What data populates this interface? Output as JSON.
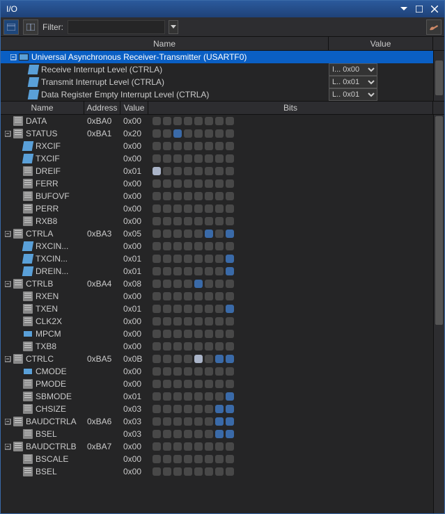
{
  "window": {
    "title": "I/O"
  },
  "toolbar": {
    "filter_label": "Filter:",
    "filter_value": ""
  },
  "upper_headers": {
    "name": "Name",
    "value": "Value"
  },
  "tree": {
    "root": "Universal Asynchronous Receiver-Transmitter (USARTF0)",
    "children": [
      {
        "label": "Receive Interrupt Level (CTRLA)",
        "value": "I... 0x00"
      },
      {
        "label": "Transmit Interrupt Level (CTRLA)",
        "value": "L.. 0x01"
      },
      {
        "label": "Data Register Empty Interrupt Level (CTRLA)",
        "value": "L.. 0x01"
      }
    ]
  },
  "lower_headers": {
    "name": "Name",
    "address": "Address",
    "value": "Value",
    "bits": "Bits"
  },
  "registers": [
    {
      "name": "DATA",
      "addr": "0xBA0",
      "val": "0x00",
      "indent": 0,
      "icon": "doc",
      "expand": null,
      "bits": [
        0,
        0,
        0,
        0,
        0,
        0,
        0,
        0
      ]
    },
    {
      "name": "STATUS",
      "addr": "0xBA1",
      "val": "0x20",
      "indent": 0,
      "icon": "doc",
      "expand": "open",
      "bits": [
        0,
        0,
        2,
        0,
        0,
        0,
        0,
        0
      ]
    },
    {
      "name": "RXCIF",
      "addr": "",
      "val": "0x00",
      "indent": 1,
      "icon": "flag",
      "expand": null,
      "bits": [
        0,
        0,
        0,
        0,
        0,
        0,
        0,
        0
      ]
    },
    {
      "name": "TXCIF",
      "addr": "",
      "val": "0x00",
      "indent": 1,
      "icon": "flag",
      "expand": null,
      "bits": [
        0,
        0,
        0,
        0,
        0,
        0,
        0,
        0
      ]
    },
    {
      "name": "DREIF",
      "addr": "",
      "val": "0x01",
      "indent": 1,
      "icon": "doc",
      "expand": null,
      "bits": [
        1,
        0,
        0,
        0,
        0,
        0,
        0,
        0
      ]
    },
    {
      "name": "FERR",
      "addr": "",
      "val": "0x00",
      "indent": 1,
      "icon": "doc",
      "expand": null,
      "bits": [
        0,
        0,
        0,
        0,
        0,
        0,
        0,
        0
      ]
    },
    {
      "name": "BUFOVF",
      "addr": "",
      "val": "0x00",
      "indent": 1,
      "icon": "doc",
      "expand": null,
      "bits": [
        0,
        0,
        0,
        0,
        0,
        0,
        0,
        0
      ]
    },
    {
      "name": "PERR",
      "addr": "",
      "val": "0x00",
      "indent": 1,
      "icon": "doc",
      "expand": null,
      "bits": [
        0,
        0,
        0,
        0,
        0,
        0,
        0,
        0
      ]
    },
    {
      "name": "RXB8",
      "addr": "",
      "val": "0x00",
      "indent": 1,
      "icon": "doc",
      "expand": null,
      "bits": [
        0,
        0,
        0,
        0,
        0,
        0,
        0,
        0
      ]
    },
    {
      "name": "CTRLA",
      "addr": "0xBA3",
      "val": "0x05",
      "indent": 0,
      "icon": "doc",
      "expand": "open",
      "bits": [
        0,
        0,
        0,
        0,
        0,
        2,
        0,
        2
      ]
    },
    {
      "name": "RXCIN...",
      "addr": "",
      "val": "0x00",
      "indent": 1,
      "icon": "flag",
      "expand": null,
      "bits": [
        0,
        0,
        0,
        0,
        0,
        0,
        0,
        0
      ]
    },
    {
      "name": "TXCIN...",
      "addr": "",
      "val": "0x01",
      "indent": 1,
      "icon": "flag",
      "expand": null,
      "bits": [
        0,
        0,
        0,
        0,
        0,
        0,
        0,
        2
      ]
    },
    {
      "name": "DREIN...",
      "addr": "",
      "val": "0x01",
      "indent": 1,
      "icon": "flag",
      "expand": null,
      "bits": [
        0,
        0,
        0,
        0,
        0,
        0,
        0,
        2
      ]
    },
    {
      "name": "CTRLB",
      "addr": "0xBA4",
      "val": "0x08",
      "indent": 0,
      "icon": "doc",
      "expand": "open",
      "bits": [
        0,
        0,
        0,
        0,
        2,
        0,
        0,
        0
      ]
    },
    {
      "name": "RXEN",
      "addr": "",
      "val": "0x00",
      "indent": 1,
      "icon": "doc",
      "expand": null,
      "bits": [
        0,
        0,
        0,
        0,
        0,
        0,
        0,
        0
      ]
    },
    {
      "name": "TXEN",
      "addr": "",
      "val": "0x01",
      "indent": 1,
      "icon": "doc",
      "expand": null,
      "bits": [
        0,
        0,
        0,
        0,
        0,
        0,
        0,
        2
      ]
    },
    {
      "name": "CLK2X",
      "addr": "",
      "val": "0x00",
      "indent": 1,
      "icon": "doc",
      "expand": null,
      "bits": [
        0,
        0,
        0,
        0,
        0,
        0,
        0,
        0
      ]
    },
    {
      "name": "MPCM",
      "addr": "",
      "val": "0x00",
      "indent": 1,
      "icon": "chip",
      "expand": null,
      "bits": [
        0,
        0,
        0,
        0,
        0,
        0,
        0,
        0
      ]
    },
    {
      "name": "TXB8",
      "addr": "",
      "val": "0x00",
      "indent": 1,
      "icon": "doc",
      "expand": null,
      "bits": [
        0,
        0,
        0,
        0,
        0,
        0,
        0,
        0
      ]
    },
    {
      "name": "CTRLC",
      "addr": "0xBA5",
      "val": "0x0B",
      "indent": 0,
      "icon": "doc",
      "expand": "open",
      "bits": [
        0,
        0,
        0,
        0,
        1,
        0,
        2,
        2
      ]
    },
    {
      "name": "CMODE",
      "addr": "",
      "val": "0x00",
      "indent": 1,
      "icon": "chip",
      "expand": null,
      "bits": [
        0,
        0,
        0,
        0,
        0,
        0,
        0,
        0
      ]
    },
    {
      "name": "PMODE",
      "addr": "",
      "val": "0x00",
      "indent": 1,
      "icon": "doc",
      "expand": null,
      "bits": [
        0,
        0,
        0,
        0,
        0,
        0,
        0,
        0
      ]
    },
    {
      "name": "SBMODE",
      "addr": "",
      "val": "0x01",
      "indent": 1,
      "icon": "doc",
      "expand": null,
      "bits": [
        0,
        0,
        0,
        0,
        0,
        0,
        0,
        2
      ]
    },
    {
      "name": "CHSIZE",
      "addr": "",
      "val": "0x03",
      "indent": 1,
      "icon": "doc",
      "expand": null,
      "bits": [
        0,
        0,
        0,
        0,
        0,
        0,
        2,
        2
      ]
    },
    {
      "name": "BAUDCTRLA",
      "addr": "0xBA6",
      "val": "0x03",
      "indent": 0,
      "icon": "doc",
      "expand": "open",
      "bits": [
        0,
        0,
        0,
        0,
        0,
        0,
        2,
        2
      ]
    },
    {
      "name": "BSEL",
      "addr": "",
      "val": "0x03",
      "indent": 1,
      "icon": "doc",
      "expand": null,
      "bits": [
        0,
        0,
        0,
        0,
        0,
        0,
        2,
        2
      ]
    },
    {
      "name": "BAUDCTRLB",
      "addr": "0xBA7",
      "val": "0x00",
      "indent": 0,
      "icon": "doc",
      "expand": "open",
      "bits": [
        0,
        0,
        0,
        0,
        0,
        0,
        0,
        0
      ]
    },
    {
      "name": "BSCALE",
      "addr": "",
      "val": "0x00",
      "indent": 1,
      "icon": "doc",
      "expand": null,
      "bits": [
        0,
        0,
        0,
        0,
        0,
        0,
        0,
        0
      ]
    },
    {
      "name": "BSEL",
      "addr": "",
      "val": "0x00",
      "indent": 1,
      "icon": "doc",
      "expand": null,
      "bits": [
        0,
        0,
        0,
        0,
        0,
        0,
        0,
        0
      ]
    }
  ]
}
